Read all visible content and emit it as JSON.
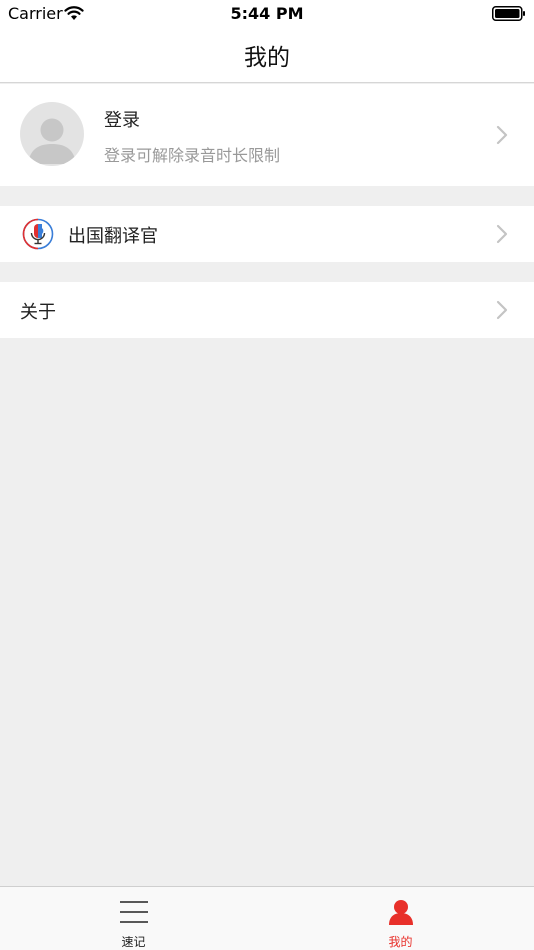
{
  "status_bar": {
    "carrier": "Carrier",
    "time": "5:44 PM"
  },
  "nav": {
    "title": "我的"
  },
  "profile": {
    "title": "登录",
    "subtitle": "登录可解除录音时长限制"
  },
  "menu": {
    "translator_label": "出国翻译官",
    "about_label": "关于"
  },
  "tabs": [
    {
      "label": "速记",
      "icon": "menu-lines-icon",
      "active": false
    },
    {
      "label": "我的",
      "icon": "person-icon",
      "active": true
    }
  ],
  "colors": {
    "accent": "#e8302a",
    "background": "#efefef"
  }
}
